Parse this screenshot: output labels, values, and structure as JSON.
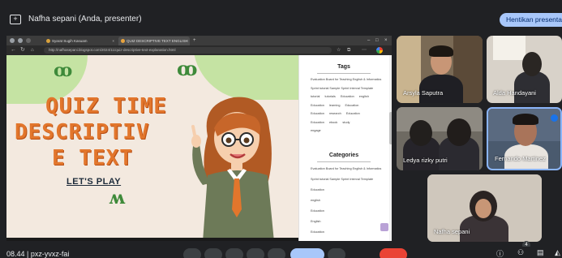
{
  "topbar": {
    "presenter_text": "Nafha sepani (Anda, presenter)",
    "stop_button": "Hentikan presentasi"
  },
  "browser": {
    "tab1_title": "Syarat Sugih Kasuam",
    "tab2_title": "QUIZ DESCRIPTIVE TEXT ENGLISH",
    "url": "http://nafhasepani.blogspot.com/2024/11/quiz-descriptive-text-explanation.html"
  },
  "slide": {
    "title_line1": "QUIZ TIME",
    "title_line2": "DESCRIPTIV",
    "title_line3": "E TEXT",
    "lets_play": "LET'S PLAY"
  },
  "sidebar": {
    "tags_heading": "Tags",
    "tag_rows": [
      [
        "Evaluation Board for Teaching English & Informatics"
      ],
      [
        "Sprint tutorial Sample Sprint Interval Template"
      ],
      [
        "tutorial",
        "tutorials",
        "Education",
        "english"
      ],
      [
        "Education",
        "learning",
        "Education"
      ],
      [
        "Education",
        "research",
        "Education"
      ],
      [
        "Education",
        "ebook",
        "study"
      ],
      [
        "engage"
      ]
    ],
    "categories_heading": "Categories",
    "category_items": [
      "Evaluation Board for Teaching English & Informatics",
      "Sprint tutorial Sample Sprint Interval Template",
      "Education",
      "english",
      "Education",
      "English",
      "Education"
    ]
  },
  "participants": [
    {
      "name": "Arsyla Saputra"
    },
    {
      "name": "Alda Handayani"
    },
    {
      "name": "Ledya rizky putri"
    },
    {
      "name": "Fernando Martinez"
    },
    {
      "name": "Nafha sepani"
    }
  ],
  "bottombar": {
    "time": "08.44 | pxz-yvxz-fai"
  },
  "colors": {
    "accent": "#a8c7fa",
    "title_orange": "#e2762c",
    "leaf_green": "#c5e3a3",
    "end_call": "#ea4335"
  }
}
